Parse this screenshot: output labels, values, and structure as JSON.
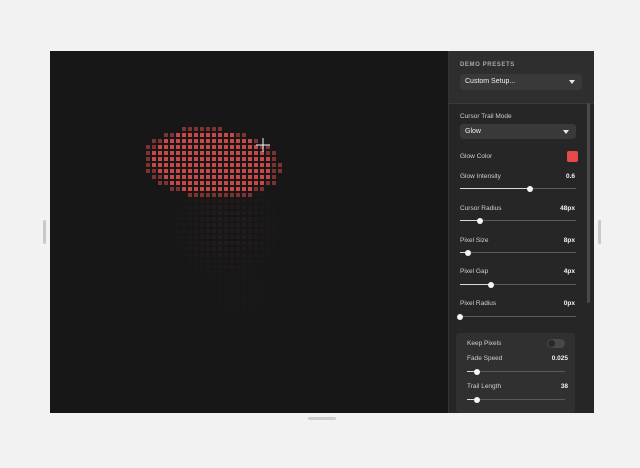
{
  "presets": {
    "title": "DEMO PRESETS",
    "selected": "Custom Setup..."
  },
  "controls": {
    "trail_mode": {
      "label": "Cursor Trail Mode",
      "selected": "Glow"
    },
    "glow_color": {
      "label": "Glow Color",
      "color": "#e84848"
    },
    "glow_intensity": {
      "label": "Glow Intensity",
      "value": "0.6",
      "level": 0.6
    },
    "cursor_radius": {
      "label": "Cursor Radius",
      "value": "48px",
      "level": 0.17
    },
    "pixel_size": {
      "label": "Pixel Size",
      "value": "8px",
      "level": 0.07
    },
    "pixel_gap": {
      "label": "Pixel Gap",
      "value": "4px",
      "level": 0.27
    },
    "pixel_radius": {
      "label": "Pixel Radius",
      "value": "0px",
      "level": 0.0
    },
    "keep_pixels": {
      "label": "Keep Pixels",
      "on": false
    },
    "fade_speed": {
      "label": "Fade Speed",
      "value": "0.025",
      "level": 0.1
    },
    "trail_length": {
      "label": "Trail Length",
      "value": "38",
      "level": 0.1
    }
  },
  "colors": {
    "pixel_active": "#d34a4a",
    "canvas_bg": "#171717",
    "panel_bg": "#262626"
  },
  "icons": {
    "cursor": "crosshair-icon"
  }
}
